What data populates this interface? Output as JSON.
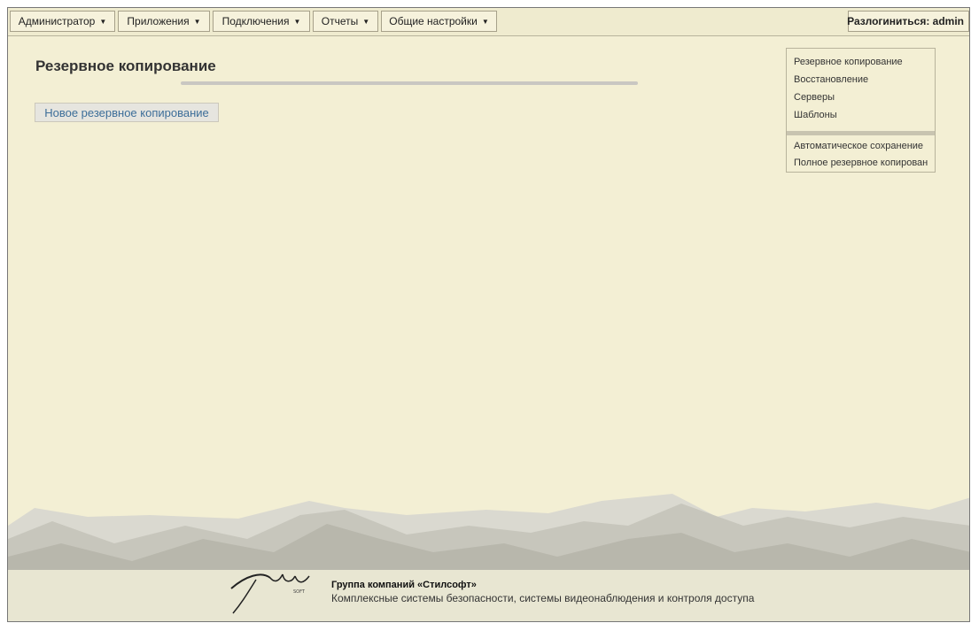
{
  "menu": {
    "items": [
      {
        "label": "Администратор",
        "arrow": "▼"
      },
      {
        "label": "Приложения",
        "arrow": "▼"
      },
      {
        "label": "Подключения",
        "arrow": "▼"
      },
      {
        "label": "Отчеты",
        "arrow": "▼"
      },
      {
        "label": "Общие настройки",
        "arrow": "▼"
      }
    ],
    "logout_label": "Разлогиниться: admin"
  },
  "main": {
    "title": "Резервное копирование",
    "new_backup_label": "Новое резервное копирование"
  },
  "sidebar": {
    "group1": [
      "Резервное копирование",
      "Восстановление",
      "Серверы",
      "Шаблоны"
    ],
    "group2": [
      "Автоматическое сохранение",
      "Полное резервное копирован"
    ]
  },
  "footer": {
    "company": "Группа компаний «Стилсофт»",
    "subtitle": "Комплексные системы безопасности, системы видеонаблюдения и контроля доступа"
  },
  "colors": {
    "background": "#f3efd4",
    "link": "#3d6e99",
    "mountain_light": "#d6d5cc",
    "mountain_dark": "#b6b5ab"
  }
}
